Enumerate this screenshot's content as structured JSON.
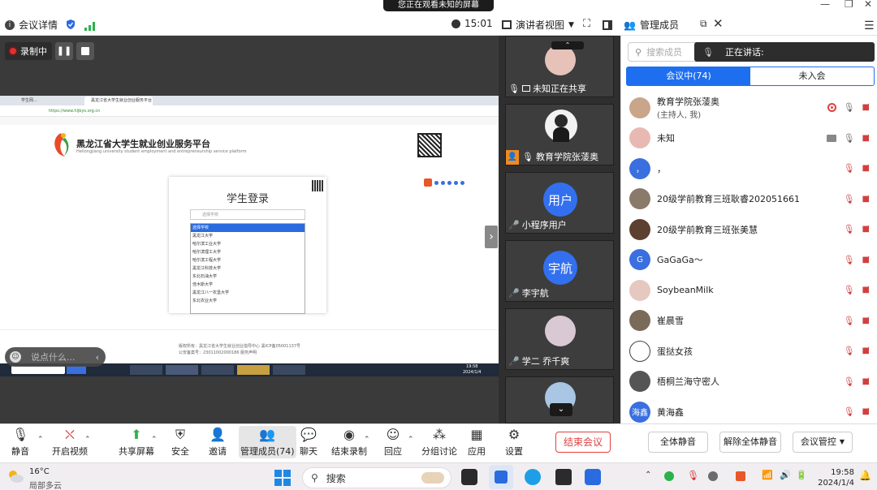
{
  "share_banner": "您正在观看未知的屏幕",
  "topbar": {
    "meeting_details": "会议详情",
    "time": "15:01",
    "speaker_view": "演讲者视图",
    "manage_members": "管理成员"
  },
  "recording": {
    "label": "录制中"
  },
  "shared_screen": {
    "tabs": [
      "学生网…",
      "黑龙江省大学生就业创业服务平台"
    ],
    "url": "https://www.hljbys.org.cn",
    "platform_title": "黑龙江省大学生就业创业服务平台",
    "platform_subtitle": "Heilongjiang university student employment and entrepreneurship service platform",
    "login_title": "学生登录",
    "select_placeholder": "选择学校",
    "dropdown_items": [
      "选择学校",
      "黑龙江大学",
      "哈尔滨工业大学",
      "哈尔滨理工大学",
      "哈尔滨工程大学",
      "黑龙江科技大学",
      "东北石油大学",
      "佳木斯大学",
      "黑龙江八一农垦大学",
      "东北农业大学"
    ],
    "footer_line1": "版权所有：黑龙江省大学生就业创业指导中心 黑ICP备05001137号",
    "footer_line2": "公安备案号：23011002000186  服务声明",
    "taskbar_time": "19:58",
    "taskbar_date": "2024/1/4"
  },
  "chat_input": {
    "placeholder": "说点什么..."
  },
  "video_tiles": [
    {
      "name": "未知正在共享"
    },
    {
      "name": "教育学院张蓤奥"
    },
    {
      "name": "小程序用户",
      "avatar_text": "用户"
    },
    {
      "name": "李宇航",
      "avatar_text": "宇航"
    },
    {
      "name": "学二 乔千爽"
    }
  ],
  "panel": {
    "search_placeholder": "搜索成员",
    "speaking_label": "正在讲话:",
    "tab_in_meeting": "会议中(74)",
    "tab_not_joined": "未入会",
    "members": [
      {
        "name": "教育学院张蓤奥",
        "sub": "(主持人, 我)",
        "avatar_color": "#c9a58a",
        "avatar_text": ""
      },
      {
        "name": "未知",
        "sub": "",
        "avatar_color": "#e8b9b3",
        "avatar_text": ""
      },
      {
        "name": "，",
        "sub": "",
        "avatar_color": "#3a6fe0",
        "avatar_text": "，"
      },
      {
        "name": "20级学前教育三班耿睿202051661",
        "sub": "",
        "avatar_color": "#8a7a6a",
        "avatar_text": ""
      },
      {
        "name": "20级学前教育三班张美慧",
        "sub": "",
        "avatar_color": "#5c4030",
        "avatar_text": ""
      },
      {
        "name": "GaGaGa～",
        "sub": "",
        "avatar_color": "#3a6fe0",
        "avatar_text": "G"
      },
      {
        "name": "SoybeanMilk",
        "sub": "",
        "avatar_color": "#e6c8c0",
        "avatar_text": ""
      },
      {
        "name": "崔晨雪",
        "sub": "",
        "avatar_color": "#7a6a5a",
        "avatar_text": ""
      },
      {
        "name": "蛋挞女孩",
        "sub": "",
        "avatar_color": "#ffffff",
        "avatar_text": ""
      },
      {
        "name": "梧桐兰海守密人",
        "sub": "",
        "avatar_color": "#555555",
        "avatar_text": ""
      },
      {
        "name": "黄海鑫",
        "sub": "",
        "avatar_color": "#3a6fe0",
        "avatar_text": "海鑫"
      }
    ],
    "mute_all": "全体静音",
    "unmute_all": "解除全体静音",
    "meeting_control": "会议管控"
  },
  "toolbar": {
    "mute": "静音",
    "video": "开启视频",
    "share": "共享屏幕",
    "security": "安全",
    "invite": "邀请",
    "members": "管理成员(74)",
    "chat": "聊天",
    "end_record": "结束录制",
    "react": "回应",
    "breakout": "分组讨论",
    "apps": "应用",
    "settings": "设置",
    "end_meeting": "结束会议"
  },
  "taskbar": {
    "weather_temp": "16°C",
    "weather_desc": "局部多云",
    "search": "搜索",
    "time": "19:58",
    "date": "2024/1/4"
  },
  "colors": {
    "accent": "#1e6ff0",
    "danger": "#e04040"
  }
}
